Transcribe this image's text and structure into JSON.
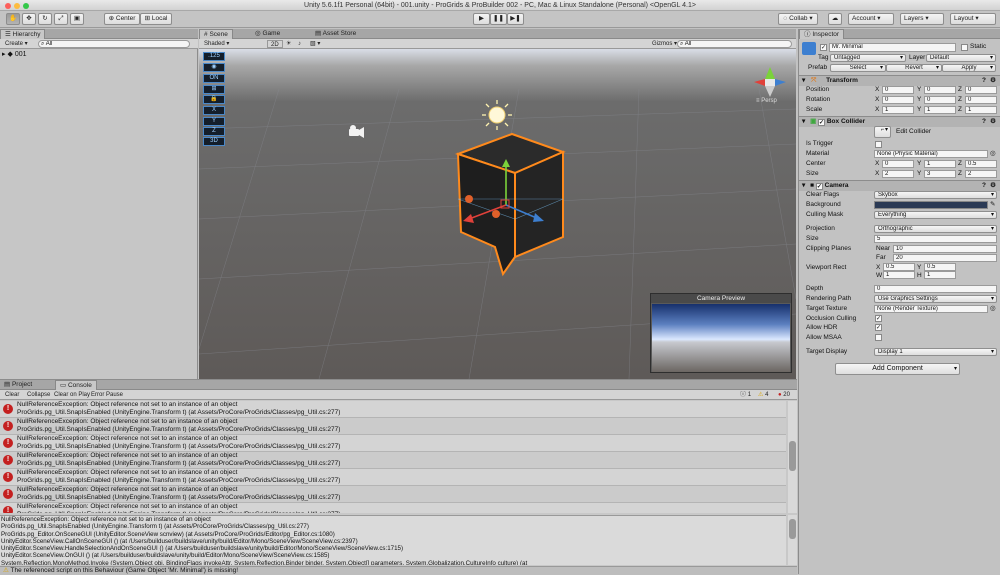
{
  "window": {
    "title": "Unity 5.6.1f1 Personal (64bit) - 001.unity - ProGrids & ProBuilder 002 - PC, Mac & Linux Standalone (Personal) <OpenGL 4.1>"
  },
  "toolbar": {
    "tools": [
      "hand-tool",
      "move-tool",
      "rotate-tool",
      "scale-tool",
      "rect-tool"
    ],
    "pivot_label": "Center",
    "space_label": "Local",
    "play_icons": [
      "play-icon",
      "pause-icon",
      "step-icon"
    ],
    "collab_label": "Collab",
    "account_label": "Account",
    "layers_label": "Layers",
    "layout_label": "Layout"
  },
  "hierarchy": {
    "tab": "Hierarchy",
    "create_label": "Create",
    "search_placeholder": "All",
    "scene_name": "001"
  },
  "scene": {
    "tabs": [
      "Scene",
      "Game",
      "Asset Store"
    ],
    "shading_mode": "Shaded",
    "mode_2d": "2D",
    "gizmos_label": "Gizmos",
    "search_placeholder": "All",
    "persp_label": "Persp",
    "progrids": {
      "snap_value": ".125",
      "items": [
        "eye",
        "on",
        "snap",
        "grid",
        "lock",
        "X",
        "Y",
        "Z",
        "3D"
      ],
      "on_label": "ON",
      "x_label": "X",
      "y_label": "Y",
      "z_label": "Z",
      "d3_label": "3D"
    },
    "camera_preview_title": "Camera Preview"
  },
  "console": {
    "tabs": [
      "Project",
      "Console"
    ],
    "buttons": [
      "Clear",
      "Collapse",
      "Clear on Play",
      "Error Pause"
    ],
    "counts": {
      "info": "1",
      "warn": "4",
      "error": "20"
    },
    "entries": [
      {
        "line1": "NullReferenceException: Object reference not set to an instance of an object",
        "line2": "ProGrids.pg_Util.SnapIsEnabled (UnityEngine.Transform t) (at Assets/ProCore/ProGrids/Classes/pg_Util.cs:277)"
      },
      {
        "line1": "NullReferenceException: Object reference not set to an instance of an object",
        "line2": "ProGrids.pg_Util.SnapIsEnabled (UnityEngine.Transform t) (at Assets/ProCore/ProGrids/Classes/pg_Util.cs:277)"
      },
      {
        "line1": "NullReferenceException: Object reference not set to an instance of an object",
        "line2": "ProGrids.pg_Util.SnapIsEnabled (UnityEngine.Transform t) (at Assets/ProCore/ProGrids/Classes/pg_Util.cs:277)"
      },
      {
        "line1": "NullReferenceException: Object reference not set to an instance of an object",
        "line2": "ProGrids.pg_Util.SnapIsEnabled (UnityEngine.Transform t) (at Assets/ProCore/ProGrids/Classes/pg_Util.cs:277)"
      },
      {
        "line1": "NullReferenceException: Object reference not set to an instance of an object",
        "line2": "ProGrids.pg_Util.SnapIsEnabled (UnityEngine.Transform t) (at Assets/ProCore/ProGrids/Classes/pg_Util.cs:277)"
      },
      {
        "line1": "NullReferenceException: Object reference not set to an instance of an object",
        "line2": "ProGrids.pg_Util.SnapIsEnabled (UnityEngine.Transform t) (at Assets/ProCore/ProGrids/Classes/pg_Util.cs:277)"
      },
      {
        "line1": "NullReferenceException: Object reference not set to an instance of an object",
        "line2": "ProGrids.pg_Util.SnapIsEnabled (UnityEngine.Transform t) (at Assets/ProCore/ProGrids/Classes/pg_Util.cs:277)"
      }
    ],
    "detail": [
      "NullReferenceException: Object reference not set to an instance of an object",
      "ProGrids.pg_Util.SnapIsEnabled (UnityEngine.Transform t) (at Assets/ProCore/ProGrids/Classes/pg_Util.cs:277)",
      "ProGrids.pg_Editor.OnSceneGUI (UnityEditor.SceneView scnview) (at Assets/ProCore/ProGrids/Editor/pg_Editor.cs:1080)",
      "UnityEditor.SceneView.CallOnSceneGUI () (at /Users/builduser/buildslave/unity/build/Editor/Mono/SceneView/SceneView.cs:2397)",
      "UnityEditor.SceneView.HandleSelectionAndOnSceneGUI () (at /Users/builduser/buildslave/unity/build/Editor/Mono/SceneView/SceneView.cs:1715)",
      "UnityEditor.SceneView.OnGUI () (at /Users/builduser/buildslave/unity/build/Editor/Mono/SceneView/SceneView.cs:1585)",
      "System.Reflection.MonoMethod.Invoke (System.Object obj, BindingFlags invokeAttr, System.Reflection.Binder binder, System.Object[] parameters, System.Globalization.CultureInfo culture) (at"
    ],
    "status_message": "The referenced script on this Behaviour (Game Object 'Mr. Minimal') is missing!"
  },
  "inspector": {
    "tab": "Inspector",
    "object_name": "Mr. Minimal",
    "static_label": "Static",
    "tag_label": "Tag",
    "tag_value": "Untagged",
    "layer_label": "Layer",
    "layer_value": "Default",
    "prefab_label": "Prefab",
    "prefab_buttons": [
      "Select",
      "Revert",
      "Apply"
    ],
    "transform": {
      "title": "Transform",
      "rows": [
        {
          "label": "Position",
          "x": "0",
          "y": "0",
          "z": "0"
        },
        {
          "label": "Rotation",
          "x": "0",
          "y": "0",
          "z": "0"
        },
        {
          "label": "Scale",
          "x": "1",
          "y": "1",
          "z": "1"
        }
      ],
      "axis": [
        "X",
        "Y",
        "Z"
      ]
    },
    "box_collider": {
      "title": "Box Collider",
      "edit_label": "Edit Collider",
      "is_trigger_label": "Is Trigger",
      "material_label": "Material",
      "material_value": "None (Physic Material)",
      "center_label": "Center",
      "center": {
        "x": "0",
        "y": "1",
        "z": "0.5"
      },
      "size_label": "Size",
      "size": {
        "x": "2",
        "y": "3",
        "z": "2"
      }
    },
    "camera": {
      "title": "Camera",
      "clear_flags_label": "Clear Flags",
      "clear_flags_value": "Skybox",
      "background_label": "Background",
      "background_color": "#2b3a55",
      "culling_mask_label": "Culling Mask",
      "culling_mask_value": "Everything",
      "projection_label": "Projection",
      "projection_value": "Orthographic",
      "size_label": "Size",
      "size_value": "5",
      "clipping_label": "Clipping Planes",
      "near_label": "Near",
      "near_value": "10",
      "far_label": "Far",
      "far_value": "20",
      "viewport_label": "Viewport Rect",
      "vp_x": "0.5",
      "vp_y": "0.5",
      "vp_w": "1",
      "vp_h": "1",
      "x_label": "X",
      "y_label": "Y",
      "w_label": "W",
      "h_label": "H",
      "depth_label": "Depth",
      "depth_value": "0",
      "rendering_path_label": "Rendering Path",
      "rendering_path_value": "Use Graphics Settings",
      "target_texture_label": "Target Texture",
      "target_texture_value": "None (Render Texture)",
      "occlusion_label": "Occlusion Culling",
      "hdr_label": "Allow HDR",
      "msaa_label": "Allow MSAA",
      "target_display_label": "Target Display",
      "target_display_value": "Display 1"
    },
    "add_component_label": "Add Component"
  },
  "colors": {
    "selection_orange": "#ff8a1c",
    "error_red": "#c42020",
    "accent_blue": "#3d7fd0"
  }
}
